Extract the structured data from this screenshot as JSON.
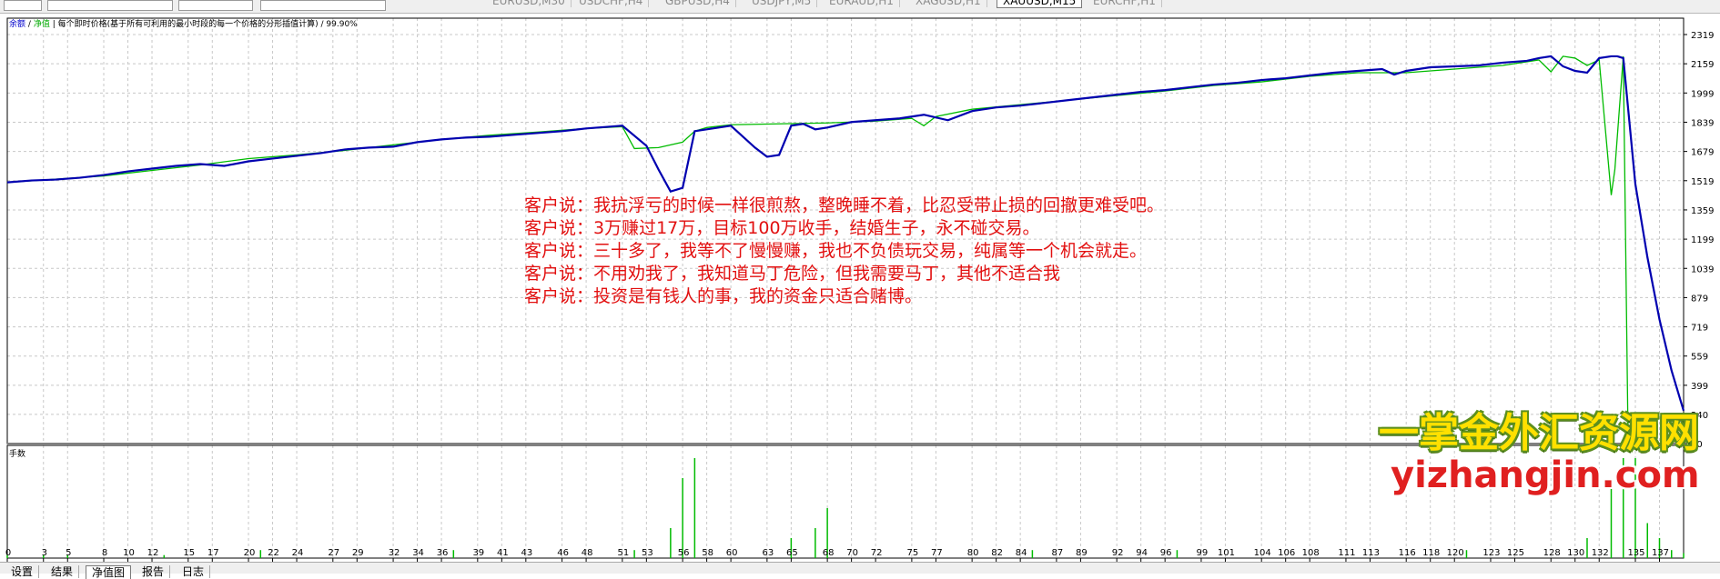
{
  "top_tabs": [
    {
      "label": "EURUSD,M30",
      "active": false
    },
    {
      "label": "USDCHF,H4",
      "active": false
    },
    {
      "label": "GBPUSD,H4",
      "active": false
    },
    {
      "label": "USDJPY,M5",
      "active": false
    },
    {
      "label": "EURAUD,H1",
      "active": false
    },
    {
      "label": "XAGUSD,H1",
      "active": false
    },
    {
      "label": "XAUUSD,M15",
      "active": true
    },
    {
      "label": "EURCHF,H1",
      "active": false
    }
  ],
  "legend": {
    "balance_label": "余额",
    "separator": "/",
    "equity_label": "净值",
    "description": "每个即时价格(基于所有可利用的最小时段的每一个价格的分形插值计算) / 99.90%"
  },
  "volume_label": "手数",
  "quotes": [
    "客户说：我抗浮亏的时候一样很煎熬，整晚睡不着，比忍受带止损的回撤更难受吧。",
    "客户说：3万赚过17万，目标100万收手，结婚生子，永不碰交易。",
    "客户说：三十多了，我等不了慢慢赚，我也不负债玩交易，纯属等一个机会就走。",
    "客户说：不用劝我了，我知道马丁危险，但我需要马丁，其他不适合我",
    "客户说：投资是有钱人的事，我的资金只适合赌博。"
  ],
  "watermark": {
    "cn": "一掌金外汇资源网",
    "url": "yizhangjin.com"
  },
  "bottom_tabs": [
    {
      "label": "设置",
      "active": false
    },
    {
      "label": "结果",
      "active": false
    },
    {
      "label": "净值图",
      "active": true
    },
    {
      "label": "报告",
      "active": false
    },
    {
      "label": "日志",
      "active": false
    }
  ],
  "colors": {
    "balance": "#0000b0",
    "equity": "#00bb00",
    "volume": "#00bb00",
    "grid": "#c8c8c8"
  },
  "chart_data": {
    "type": "line",
    "y_ticks": [
      2319,
      2159,
      1999,
      1839,
      1679,
      1519,
      1359,
      1199,
      1039,
      879,
      719,
      559,
      399,
      240,
      80
    ],
    "ylim": [
      80,
      2319
    ],
    "x_ticks": [
      0,
      3,
      5,
      8,
      10,
      12,
      15,
      17,
      20,
      22,
      24,
      27,
      29,
      32,
      34,
      36,
      39,
      41,
      43,
      46,
      48,
      51,
      53,
      56,
      58,
      60,
      63,
      65,
      68,
      70,
      72,
      75,
      77,
      80,
      82,
      84,
      87,
      89,
      92,
      94,
      96,
      99,
      101,
      104,
      106,
      108,
      111,
      113,
      116,
      118,
      120,
      123,
      125,
      128,
      130,
      132,
      135,
      137
    ],
    "xlim": [
      0,
      139
    ],
    "series": [
      {
        "name": "余额",
        "x": [
          0,
          2,
          4,
          6,
          8,
          10,
          12,
          14,
          16,
          18,
          20,
          22,
          24,
          26,
          28,
          30,
          32,
          34,
          36,
          38,
          40,
          42,
          44,
          46,
          48,
          50,
          51,
          53,
          54,
          55,
          56,
          57,
          58,
          59,
          60,
          62,
          63,
          64,
          65,
          66,
          67,
          68,
          70,
          72,
          74,
          75,
          76,
          78,
          80,
          82,
          84,
          86,
          88,
          90,
          92,
          94,
          96,
          98,
          100,
          102,
          104,
          106,
          108,
          110,
          112,
          114,
          115,
          116,
          118,
          120,
          122,
          124,
          126,
          127,
          128,
          129,
          130,
          131,
          132,
          133,
          133.5,
          134,
          135,
          136,
          137,
          138,
          139
        ],
        "y": [
          1510,
          1520,
          1525,
          1535,
          1550,
          1570,
          1585,
          1600,
          1610,
          1600,
          1625,
          1640,
          1655,
          1670,
          1690,
          1700,
          1705,
          1730,
          1745,
          1755,
          1760,
          1770,
          1780,
          1790,
          1805,
          1815,
          1820,
          1710,
          1580,
          1460,
          1480,
          1790,
          1800,
          1810,
          1820,
          1700,
          1650,
          1660,
          1820,
          1830,
          1800,
          1810,
          1840,
          1850,
          1860,
          1870,
          1880,
          1850,
          1900,
          1920,
          1930,
          1945,
          1960,
          1975,
          1990,
          2005,
          2015,
          2030,
          2045,
          2055,
          2070,
          2080,
          2095,
          2110,
          2120,
          2130,
          2100,
          2120,
          2140,
          2145,
          2150,
          2165,
          2175,
          2190,
          2200,
          2145,
          2120,
          2110,
          2190,
          2200,
          2200,
          2190,
          1500,
          1100,
          760,
          480,
          260
        ]
      },
      {
        "name": "净值",
        "x": [
          0,
          4,
          8,
          12,
          16,
          20,
          24,
          28,
          32,
          36,
          40,
          44,
          48,
          51,
          52,
          54,
          56,
          57,
          58,
          60,
          64,
          68,
          72,
          75,
          76,
          77,
          80,
          84,
          88,
          92,
          96,
          100,
          104,
          108,
          112,
          116,
          120,
          124,
          127,
          128,
          129,
          130,
          131,
          132,
          133,
          133.3,
          134,
          134.4,
          135,
          135.5,
          136
        ],
        "y": [
          1510,
          1527,
          1545,
          1575,
          1605,
          1640,
          1660,
          1685,
          1715,
          1745,
          1768,
          1785,
          1805,
          1815,
          1695,
          1700,
          1730,
          1790,
          1810,
          1825,
          1830,
          1835,
          1845,
          1860,
          1820,
          1870,
          1910,
          1935,
          1960,
          1985,
          2010,
          2040,
          2060,
          2090,
          2110,
          2110,
          2130,
          2150,
          2180,
          2115,
          2200,
          2190,
          2150,
          2180,
          1440,
          1580,
          2200,
          80,
          80,
          80,
          80
        ]
      }
    ],
    "volume": {
      "x": [
        0,
        3,
        5,
        13,
        21,
        37,
        52,
        55,
        56,
        57,
        65,
        67,
        68,
        85,
        97,
        121,
        131,
        133,
        134,
        135,
        136,
        137,
        138,
        139
      ],
      "values": [
        3,
        3,
        3,
        3,
        8,
        8,
        8,
        30,
        80,
        100,
        20,
        30,
        50,
        8,
        8,
        8,
        20,
        70,
        100,
        100,
        35,
        20,
        8,
        5
      ]
    }
  }
}
